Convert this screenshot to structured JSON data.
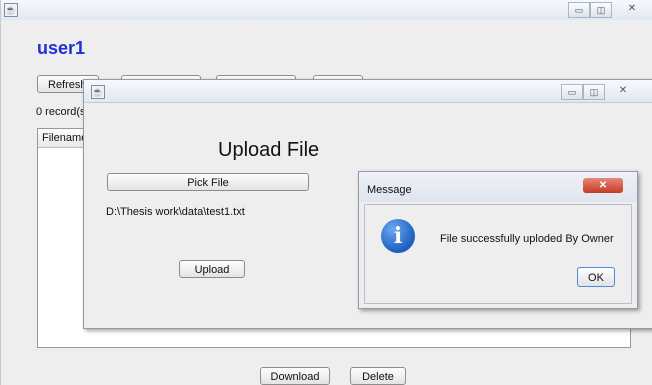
{
  "main_window": {
    "user_title": "user1",
    "toolbar": {
      "refresh_label": "Refresh"
    },
    "records_text": "0 record(s)",
    "table": {
      "columns": [
        "Filename"
      ]
    },
    "download_label": "Download",
    "delete_label": "Delete"
  },
  "upload_dialog": {
    "heading": "Upload File",
    "pick_file_label": "Pick File",
    "selected_path": "D:\\Thesis work\\data\\test1.txt",
    "upload_label": "Upload"
  },
  "message_dialog": {
    "title": "Message",
    "message": "File successfully uploded By Owner",
    "ok_label": "OK"
  },
  "window_controls": {
    "minimize": "▭",
    "maximize": "◫",
    "close": "✕"
  },
  "colors": {
    "user_title": "#1f2fd6",
    "close_button": "#c43b26",
    "info_icon": "#1d5fbf"
  }
}
